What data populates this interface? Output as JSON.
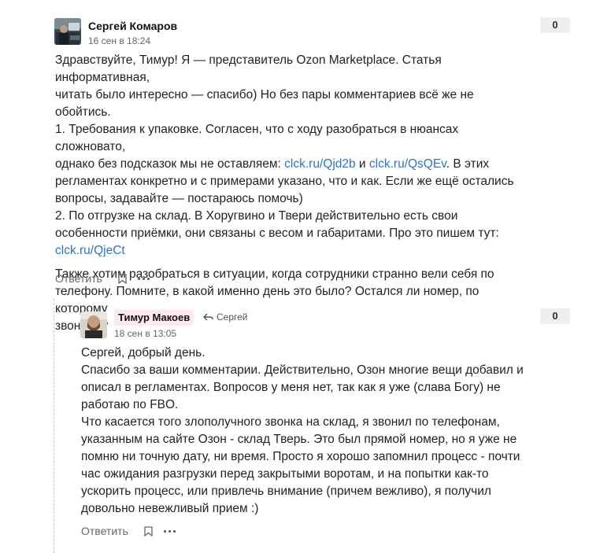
{
  "comments": [
    {
      "author": "Сергей Комаров",
      "date": "16 сен в 18:24",
      "votes": "0",
      "avatar_icon": "avatar-image",
      "p1_lines": [
        "Здравствуйте, Тимур! Я — представитель Ozon Marketplace. Статья информативная,",
        "читать было интересно — спасибо) Но без пары комментариев всё же не обойтись.",
        "1. Требования к упаковке. Согласен, что с ходу разобраться в нюансах сложновато,"
      ],
      "p1_line4_pre": "однако без подсказок мы не оставляем: ",
      "link1": "clck.ru/Qjd2b",
      "p1_and": " и ",
      "link2": "clck.ru/QsQEv",
      "p1_line4_post": ". В этих",
      "p1_lines_b": [
        "регламентах конкретно и с примерами указано, что и как. Если же ещё остались",
        "вопросы, задавайте — постараюсь помочь)",
        "2. По отгрузке на склад. В Хоругвино и Твери действительно есть свои",
        "особенности приёмки, они связаны с весом и габаритами. Про это пишем тут:"
      ],
      "link3": "clck.ru/QjeCt",
      "p2": "Также хотим разобраться в ситуации, когда сотрудники странно вели себя по\nтелефону. Помните, в какой именно день это было? Остался ли номер, по которому\nзвонили?",
      "reply_label": "Ответить"
    },
    {
      "author": "Тимур Макоев",
      "reply_to": "Сергей",
      "date": "18 сен в 13:05",
      "votes": "0",
      "avatar_icon": "avatar-image",
      "text": "Сергей, добрый день.\nСпасибо за ваши комментарии. Действительно, Озон многие вещи добавил и\nописал в регламентах. Вопросов у меня нет, так как я уже (слава Богу) не\nработаю по FBO.\nЧто касается того злополучного звонка на склад, я звонил по телефонам,\nуказанным на сайте Озон - склад Тверь. Это был прямой номер, но я уже не\nпомню ни точную дату, ни время. Просто я хорошо запомнил процесс - почти\nчас ожидания разгрузки перед закрытыми воротам, и на попытки как-то\nускорить процесс, или привлечь внимание (причем вежливо), я получил\nдовольно невежливый прием :)",
      "reply_label": "Ответить"
    }
  ],
  "colors": {
    "link": "#2f74c0",
    "highlight": "#fde8ee",
    "vote_bg": "#efefef"
  }
}
